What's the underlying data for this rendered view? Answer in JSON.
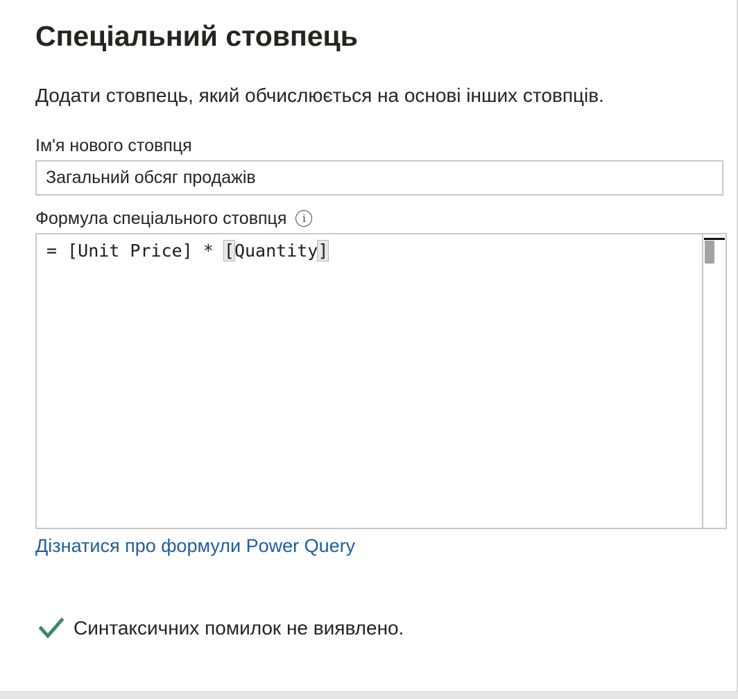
{
  "dialog": {
    "title": "Спеціальний стовпець",
    "description": "Додати стовпець, який обчислюється на основі інших стовпців."
  },
  "column_name": {
    "label": "Ім'я нового стовпця",
    "value": "Загальний обсяг продажів"
  },
  "formula": {
    "label": "Формула спеціального стовпця",
    "info_icon": "info-icon",
    "prefix": "= [Unit Price] * ",
    "open_bracket": "[",
    "field": "Quantity",
    "close_bracket": "]"
  },
  "learn_link": {
    "label": "Дізнатися про формули Power Query"
  },
  "status": {
    "icon": "checkmark-icon",
    "text": "Синтаксичних помилок не виявлено.",
    "icon_color": "#3a8a6a"
  },
  "colors": {
    "link": "#1f5fa0",
    "text": "#252423",
    "border": "#c8c8c8"
  }
}
